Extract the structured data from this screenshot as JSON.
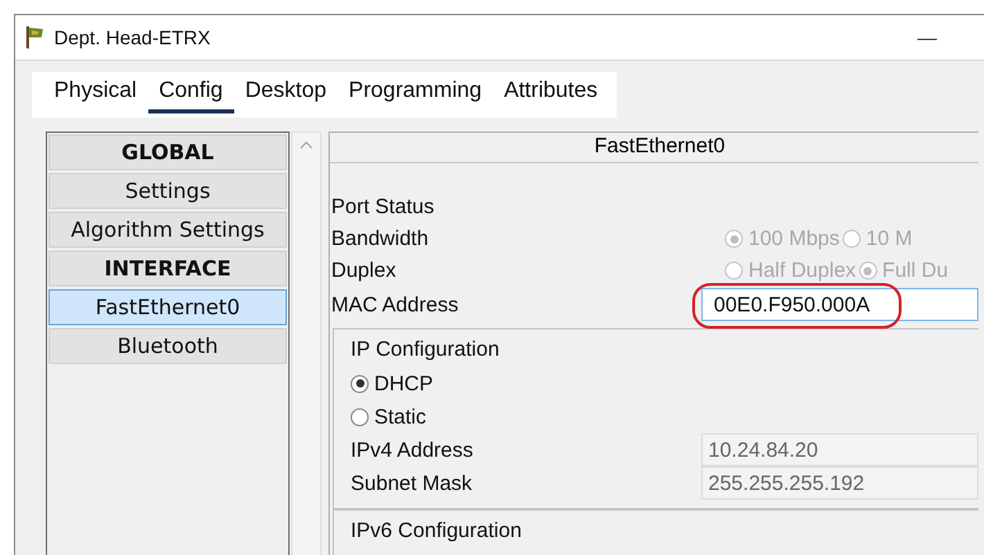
{
  "window": {
    "title": "Dept. Head-ETRX",
    "minimize": "—"
  },
  "tabs": [
    {
      "label": "Physical",
      "selected": false
    },
    {
      "label": "Config",
      "selected": true
    },
    {
      "label": "Desktop",
      "selected": false
    },
    {
      "label": "Programming",
      "selected": false
    },
    {
      "label": "Attributes",
      "selected": false
    }
  ],
  "sidebar": {
    "items": [
      {
        "label": "GLOBAL",
        "kind": "header",
        "selected": false
      },
      {
        "label": "Settings",
        "kind": "item",
        "selected": false
      },
      {
        "label": "Algorithm Settings",
        "kind": "item",
        "selected": false
      },
      {
        "label": "INTERFACE",
        "kind": "header",
        "selected": false
      },
      {
        "label": "FastEthernet0",
        "kind": "item",
        "selected": true
      },
      {
        "label": "Bluetooth",
        "kind": "item",
        "selected": false
      }
    ]
  },
  "panel": {
    "title": "FastEthernet0",
    "port_status": {
      "label": "Port Status"
    },
    "bandwidth": {
      "label": "Bandwidth",
      "disabled": true,
      "options": [
        {
          "label": "100 Mbps",
          "selected": true
        },
        {
          "label": "10 M",
          "selected": false
        }
      ]
    },
    "duplex": {
      "label": "Duplex",
      "disabled": true,
      "options": [
        {
          "label": "Half Duplex",
          "selected": false
        },
        {
          "label": "Full Du",
          "selected": true
        }
      ]
    },
    "mac_address": {
      "label": "MAC Address",
      "value": "00E0.F950.000A",
      "highlighted": true
    },
    "ip_configuration": {
      "title": "IP Configuration",
      "modes": [
        {
          "label": "DHCP",
          "selected": true
        },
        {
          "label": "Static",
          "selected": false
        }
      ],
      "fields": [
        {
          "label": "IPv4 Address",
          "value": "10.24.84.20",
          "disabled": true
        },
        {
          "label": "Subnet Mask",
          "value": "255.255.255.192",
          "disabled": true
        }
      ]
    },
    "ipv6_configuration": {
      "title": "IPv6 Configuration"
    }
  }
}
